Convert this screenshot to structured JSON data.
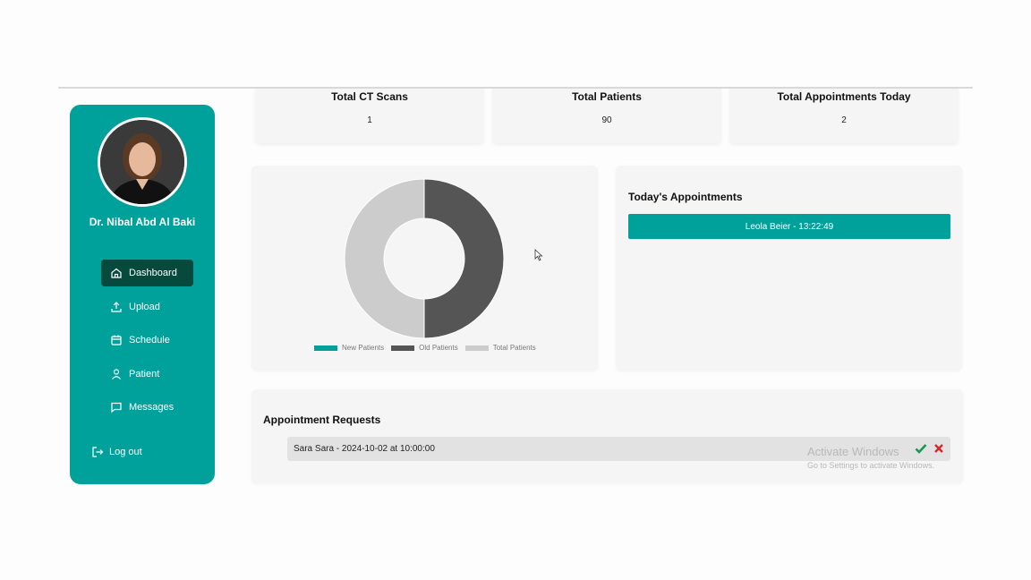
{
  "sidebar": {
    "doctor_name": "Dr. Nibal Abd Al Baki",
    "nav": [
      {
        "label": "Dashboard",
        "icon": "home-icon",
        "active": true
      },
      {
        "label": "Upload",
        "icon": "upload-icon"
      },
      {
        "label": "Schedule",
        "icon": "calendar-icon"
      },
      {
        "label": "Patient",
        "icon": "user-icon"
      },
      {
        "label": "Messages",
        "icon": "message-icon"
      }
    ],
    "logout_label": "Log out"
  },
  "stats": [
    {
      "title": "Total CT Scans",
      "value": "1"
    },
    {
      "title": "Total Patients",
      "value": "90"
    },
    {
      "title": "Total Appointments Today",
      "value": "2"
    }
  ],
  "chart_data": {
    "type": "pie",
    "donut": true,
    "categories": [
      "New Patients",
      "Old Patients",
      "Total Patients"
    ],
    "values": [
      0,
      45,
      45
    ],
    "colors": [
      "#00a19a",
      "#555555",
      "#cccccc"
    ],
    "legend": "bottom"
  },
  "todays_appointments": {
    "title": "Today's Appointments",
    "items": [
      "Leola Beier - 13:22:49"
    ]
  },
  "appointment_requests": {
    "title": "Appointment Requests",
    "items": [
      "Sara Sara - 2024-10-02 at 10:00:00"
    ]
  },
  "watermark": {
    "line1": "Activate Windows",
    "line2": "Go to Settings to activate Windows."
  },
  "colors": {
    "accent": "#00a19a",
    "active_nav": "#064a3e",
    "accept": "#1a9850",
    "reject": "#d62728"
  }
}
